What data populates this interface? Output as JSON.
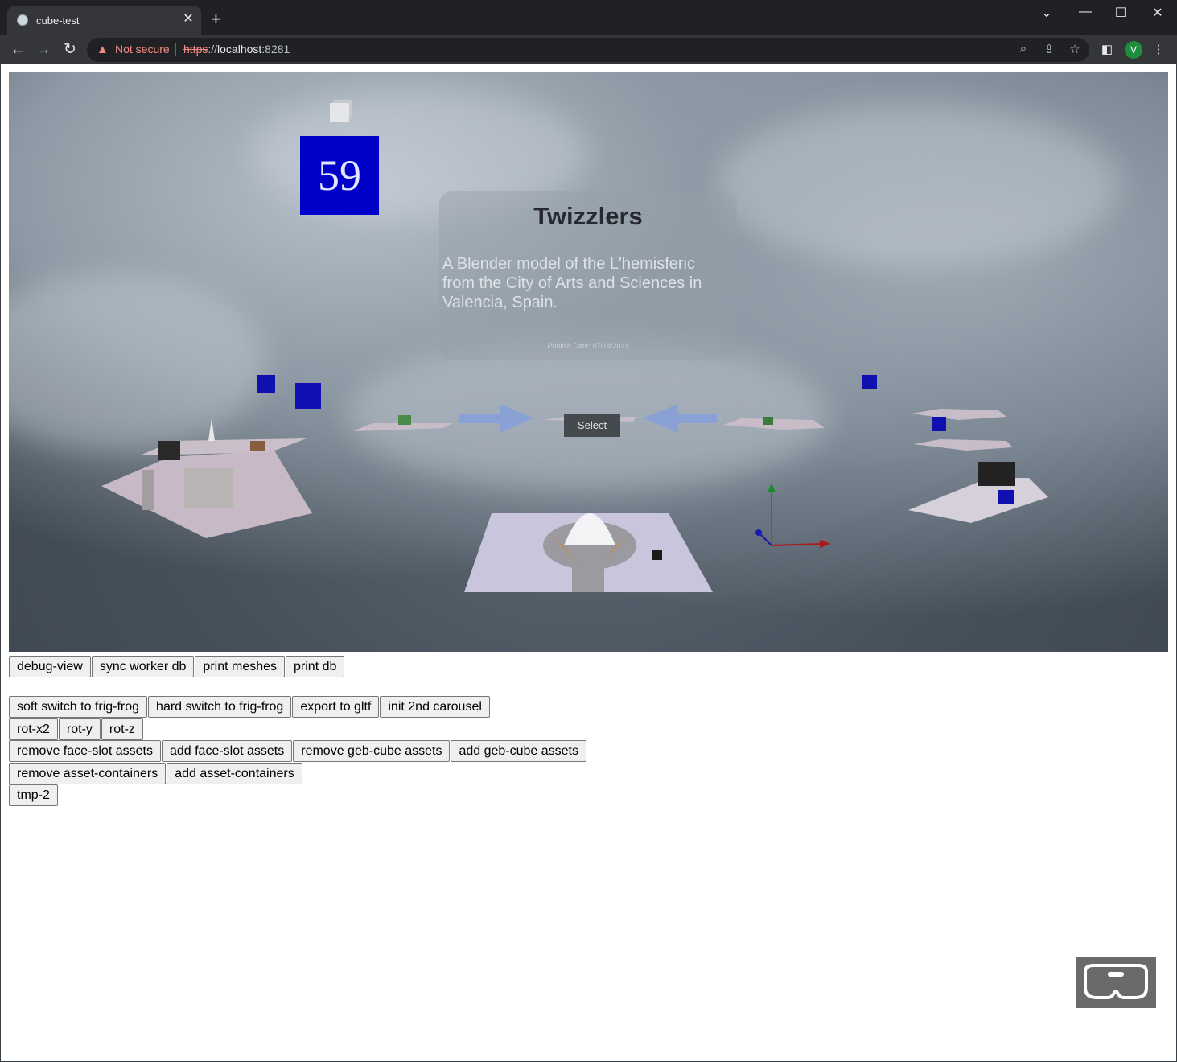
{
  "browser": {
    "tab_title": "cube-test",
    "tab_close": "✕",
    "new_tab": "+",
    "security_label": "Not secure",
    "url_scheme": "https",
    "url_sep": "://",
    "url_host": "localhost",
    "url_port": ":8281",
    "avatar_letter": "V"
  },
  "scene": {
    "card_number": "59",
    "info_title": "Twizzlers",
    "info_description": "A Blender model of the L'hemisferic from the City of Arts and Sciences in Valencia, Spain.",
    "info_date": "Publish Date: 07/14/2021",
    "select_label": "Select"
  },
  "buttons": {
    "row1": [
      "debug-view",
      "sync worker db",
      "print meshes",
      "print db"
    ],
    "row2": [
      "soft switch to frig-frog",
      "hard switch to frig-frog",
      "export to gltf",
      "init 2nd carousel"
    ],
    "row3": [
      "rot-x2",
      "rot-y",
      "rot-z"
    ],
    "row4": [
      "remove face-slot assets",
      "add face-slot assets",
      "remove geb-cube assets",
      "add geb-cube assets"
    ],
    "row5": [
      "remove asset-containers",
      "add asset-containers"
    ],
    "row6": [
      "tmp-2"
    ]
  }
}
